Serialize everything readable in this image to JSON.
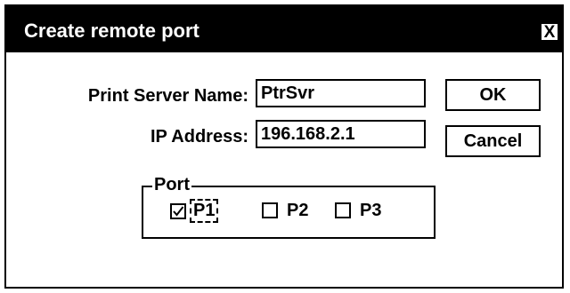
{
  "window": {
    "title": "Create remote port",
    "close_label": "X"
  },
  "form": {
    "server_name_label": "Print Server Name:",
    "server_name_value": "PtrSvr",
    "ip_label": "IP Address:",
    "ip_value": "196.168.2.1"
  },
  "buttons": {
    "ok_label": "OK",
    "cancel_label": "Cancel"
  },
  "port_group": {
    "label": "Port",
    "options": [
      {
        "label": "P1",
        "checked": true,
        "focused": true
      },
      {
        "label": "P2",
        "checked": false,
        "focused": false
      },
      {
        "label": "P3",
        "checked": false,
        "focused": false
      }
    ]
  }
}
